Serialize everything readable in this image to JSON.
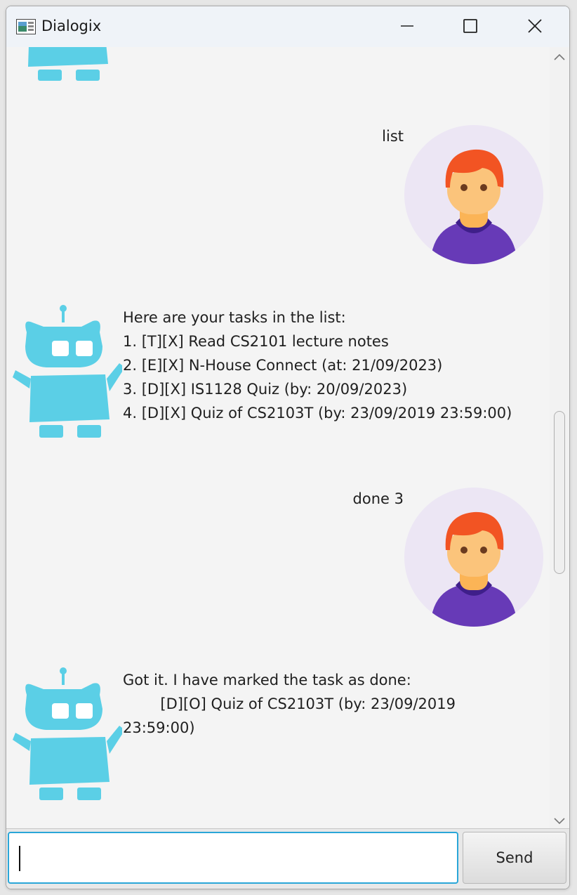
{
  "window": {
    "title": "Dialogix"
  },
  "messages": [
    {
      "sender": "bot",
      "lines": []
    },
    {
      "sender": "user",
      "text": "list"
    },
    {
      "sender": "bot",
      "text": "Here are your tasks in the list:\n1. [T][X] Read CS2101 lecture notes\n2. [E][X] N-House Connect (at: 21/09/2023)\n3. [D][X] IS1128 Quiz (by: 20/09/2023)\n4. [D][X] Quiz of CS2103T (by: 23/09/2019 23:59:00)"
    },
    {
      "sender": "user",
      "text": "done 3"
    },
    {
      "sender": "bot",
      "text": "Got it. I have marked the task as done:\n\t\t[D][O] Quiz of CS2103T (by: 23/09/2019 23:59:00)"
    }
  ],
  "input": {
    "value": "",
    "placeholder": ""
  },
  "send_button": {
    "label": "Send"
  },
  "colors": {
    "bot": "#5bcfe6",
    "user_circle": "#ece6f4",
    "user_hair": "#f25423",
    "user_skin": "#fbc47b",
    "user_shirt": "#673ab7",
    "input_focus": "#2aa6d8"
  },
  "icons": {
    "app": "app-icon",
    "minimize": "minimize-icon",
    "maximize": "maximize-icon",
    "close": "close-icon",
    "bot": "robot-avatar",
    "user": "user-avatar"
  }
}
